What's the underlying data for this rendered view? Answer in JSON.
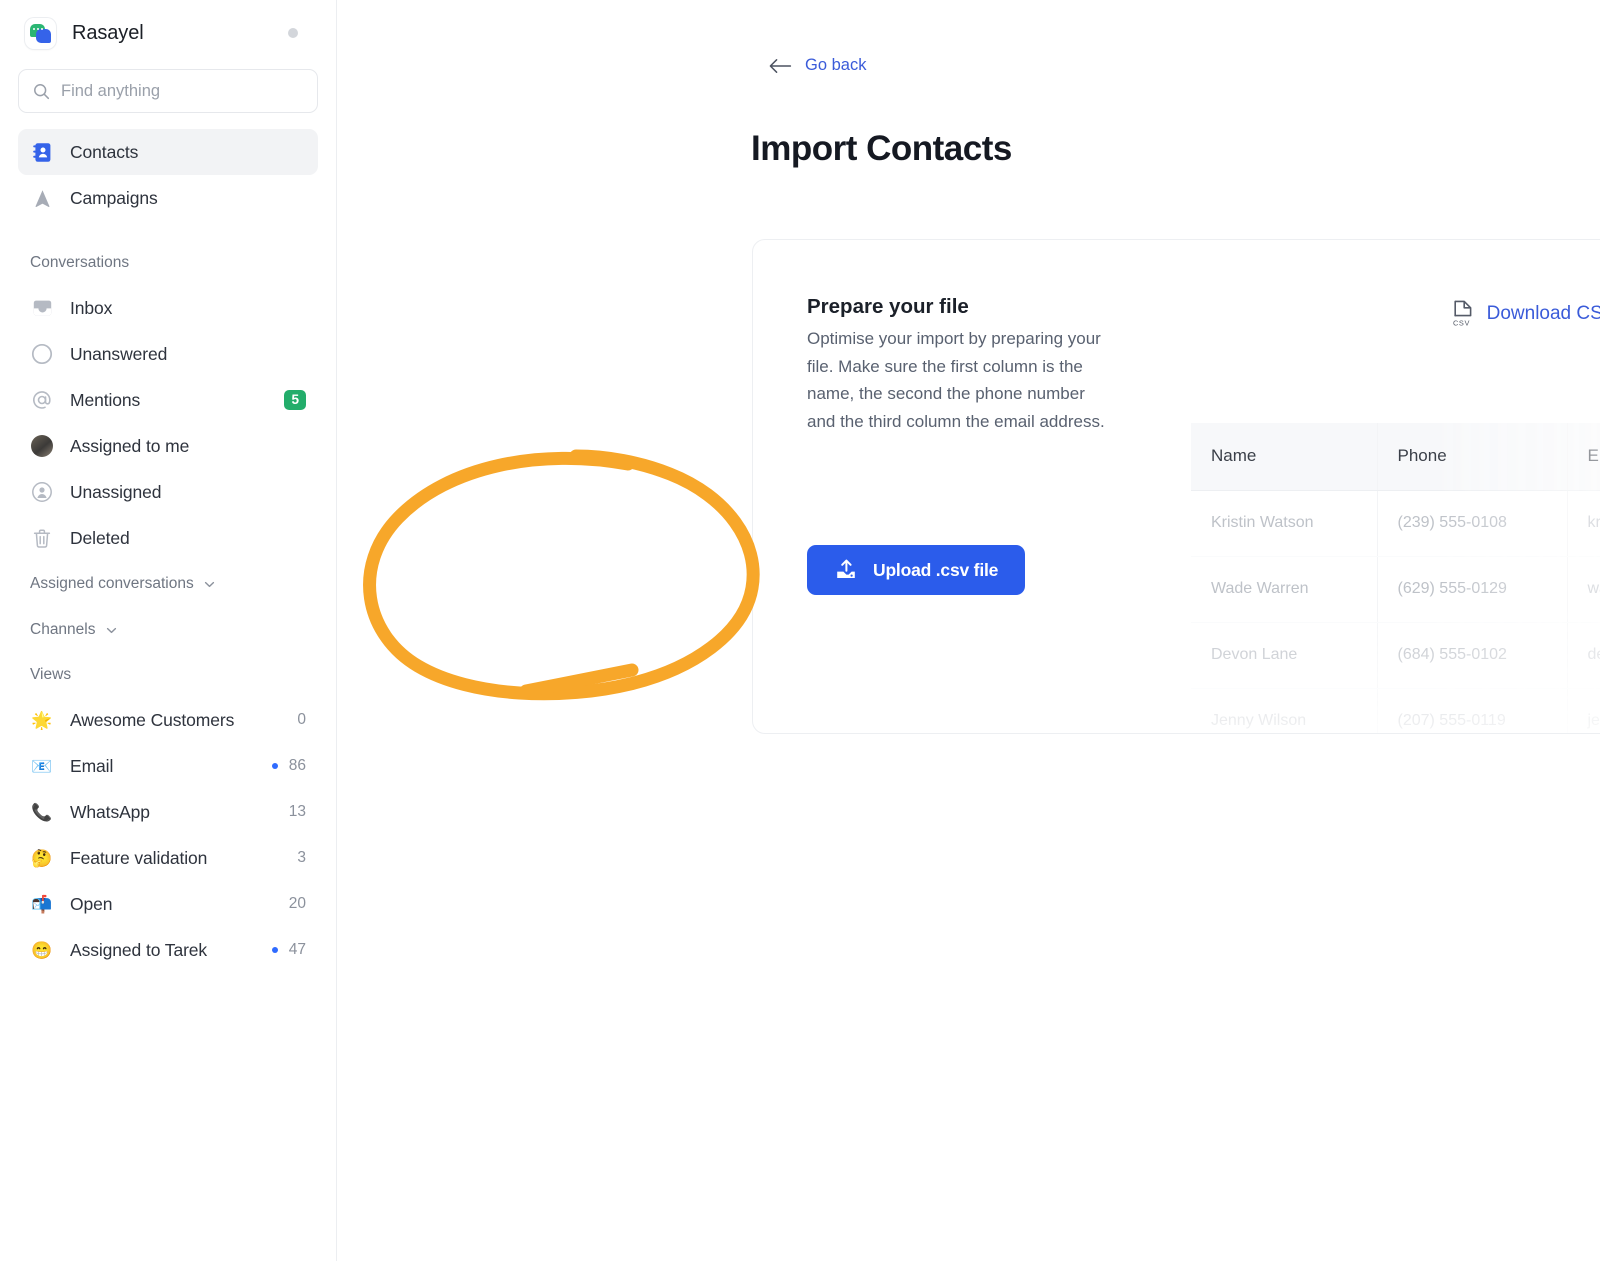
{
  "brand": {
    "name": "Rasayel",
    "logo_icon": "rasayel-logo-icon",
    "status_icon": "status-dot-icon"
  },
  "search": {
    "placeholder": "Find anything",
    "value": "",
    "icon": "search-icon"
  },
  "sidebar": {
    "primary": [
      {
        "label": "Contacts",
        "icon": "contacts-book-icon",
        "active": true
      },
      {
        "label": "Campaigns",
        "icon": "campaigns-megaphone-icon",
        "active": false
      }
    ],
    "conversations_header": "Conversations",
    "conversations": [
      {
        "label": "Inbox",
        "icon": "inbox-tray-icon",
        "count": "",
        "badge": "",
        "dot": false
      },
      {
        "label": "Unanswered",
        "icon": "circle-outline-icon",
        "count": "",
        "badge": "",
        "dot": false
      },
      {
        "label": "Mentions",
        "icon": "at-mention-icon",
        "count": "",
        "badge": "5",
        "dot": false
      },
      {
        "label": "Assigned to me",
        "icon": "user-avatar-icon",
        "count": "",
        "badge": "",
        "dot": false
      },
      {
        "label": "Unassigned",
        "icon": "user-circle-icon",
        "count": "",
        "badge": "",
        "dot": false
      },
      {
        "label": "Deleted",
        "icon": "trash-icon",
        "count": "",
        "badge": "",
        "dot": false
      }
    ],
    "collapsibles": [
      {
        "label": "Assigned conversations",
        "icon": "chevron-down-icon"
      },
      {
        "label": "Channels",
        "icon": "chevron-down-icon"
      }
    ],
    "views_header": "Views",
    "views": [
      {
        "label": "Awesome Customers",
        "emoji": "🌟",
        "count": "0",
        "dot": false
      },
      {
        "label": "Email",
        "emoji": "📧",
        "count": "86",
        "dot": true
      },
      {
        "label": "WhatsApp",
        "emoji": "📞",
        "count": "13",
        "dot": false
      },
      {
        "label": "Feature validation",
        "emoji": "🤔",
        "count": "3",
        "dot": false
      },
      {
        "label": "Open",
        "emoji": "📬",
        "count": "20",
        "dot": false
      },
      {
        "label": "Assigned to Tarek",
        "emoji": "😁",
        "count": "47",
        "dot": true
      }
    ]
  },
  "main": {
    "go_back": {
      "label": "Go back",
      "icon": "arrow-left-icon"
    },
    "page_title": "Import Contacts",
    "prepare": {
      "title": "Prepare your file",
      "body": "Optimise your import by preparing your file. Make sure the first column is the name, the second the phone number and the third column the email address."
    },
    "download_sample": {
      "label": "Download CSV sample",
      "icon": "csv-file-icon"
    },
    "upload_button": {
      "label": "Upload .csv file",
      "icon": "upload-icon"
    },
    "preview_table": {
      "columns": [
        "Name",
        "Phone",
        "Email"
      ],
      "rows": [
        [
          "Kristin Watson",
          "(239) 555-0108",
          "kristin@example.io"
        ],
        [
          "Wade Warren",
          "(629) 555-0129",
          "wade@example.io"
        ],
        [
          "Devon Lane",
          "(684) 555-0102",
          "devon@example.io"
        ],
        [
          "Jenny Wilson",
          "(207) 555-0119",
          "jenny@example.io"
        ]
      ]
    }
  },
  "annotation": {
    "shape": "hand-drawn-ellipse-highlight",
    "target": "upload-csv-button",
    "color": "#F7A72A"
  },
  "colors": {
    "accent_blue": "#2B5CEB",
    "link_blue": "#3A5BD9",
    "badge_green": "#23AD6B",
    "annotation_orange": "#F7A72A",
    "sidebar_active": "#F2F3F5"
  }
}
